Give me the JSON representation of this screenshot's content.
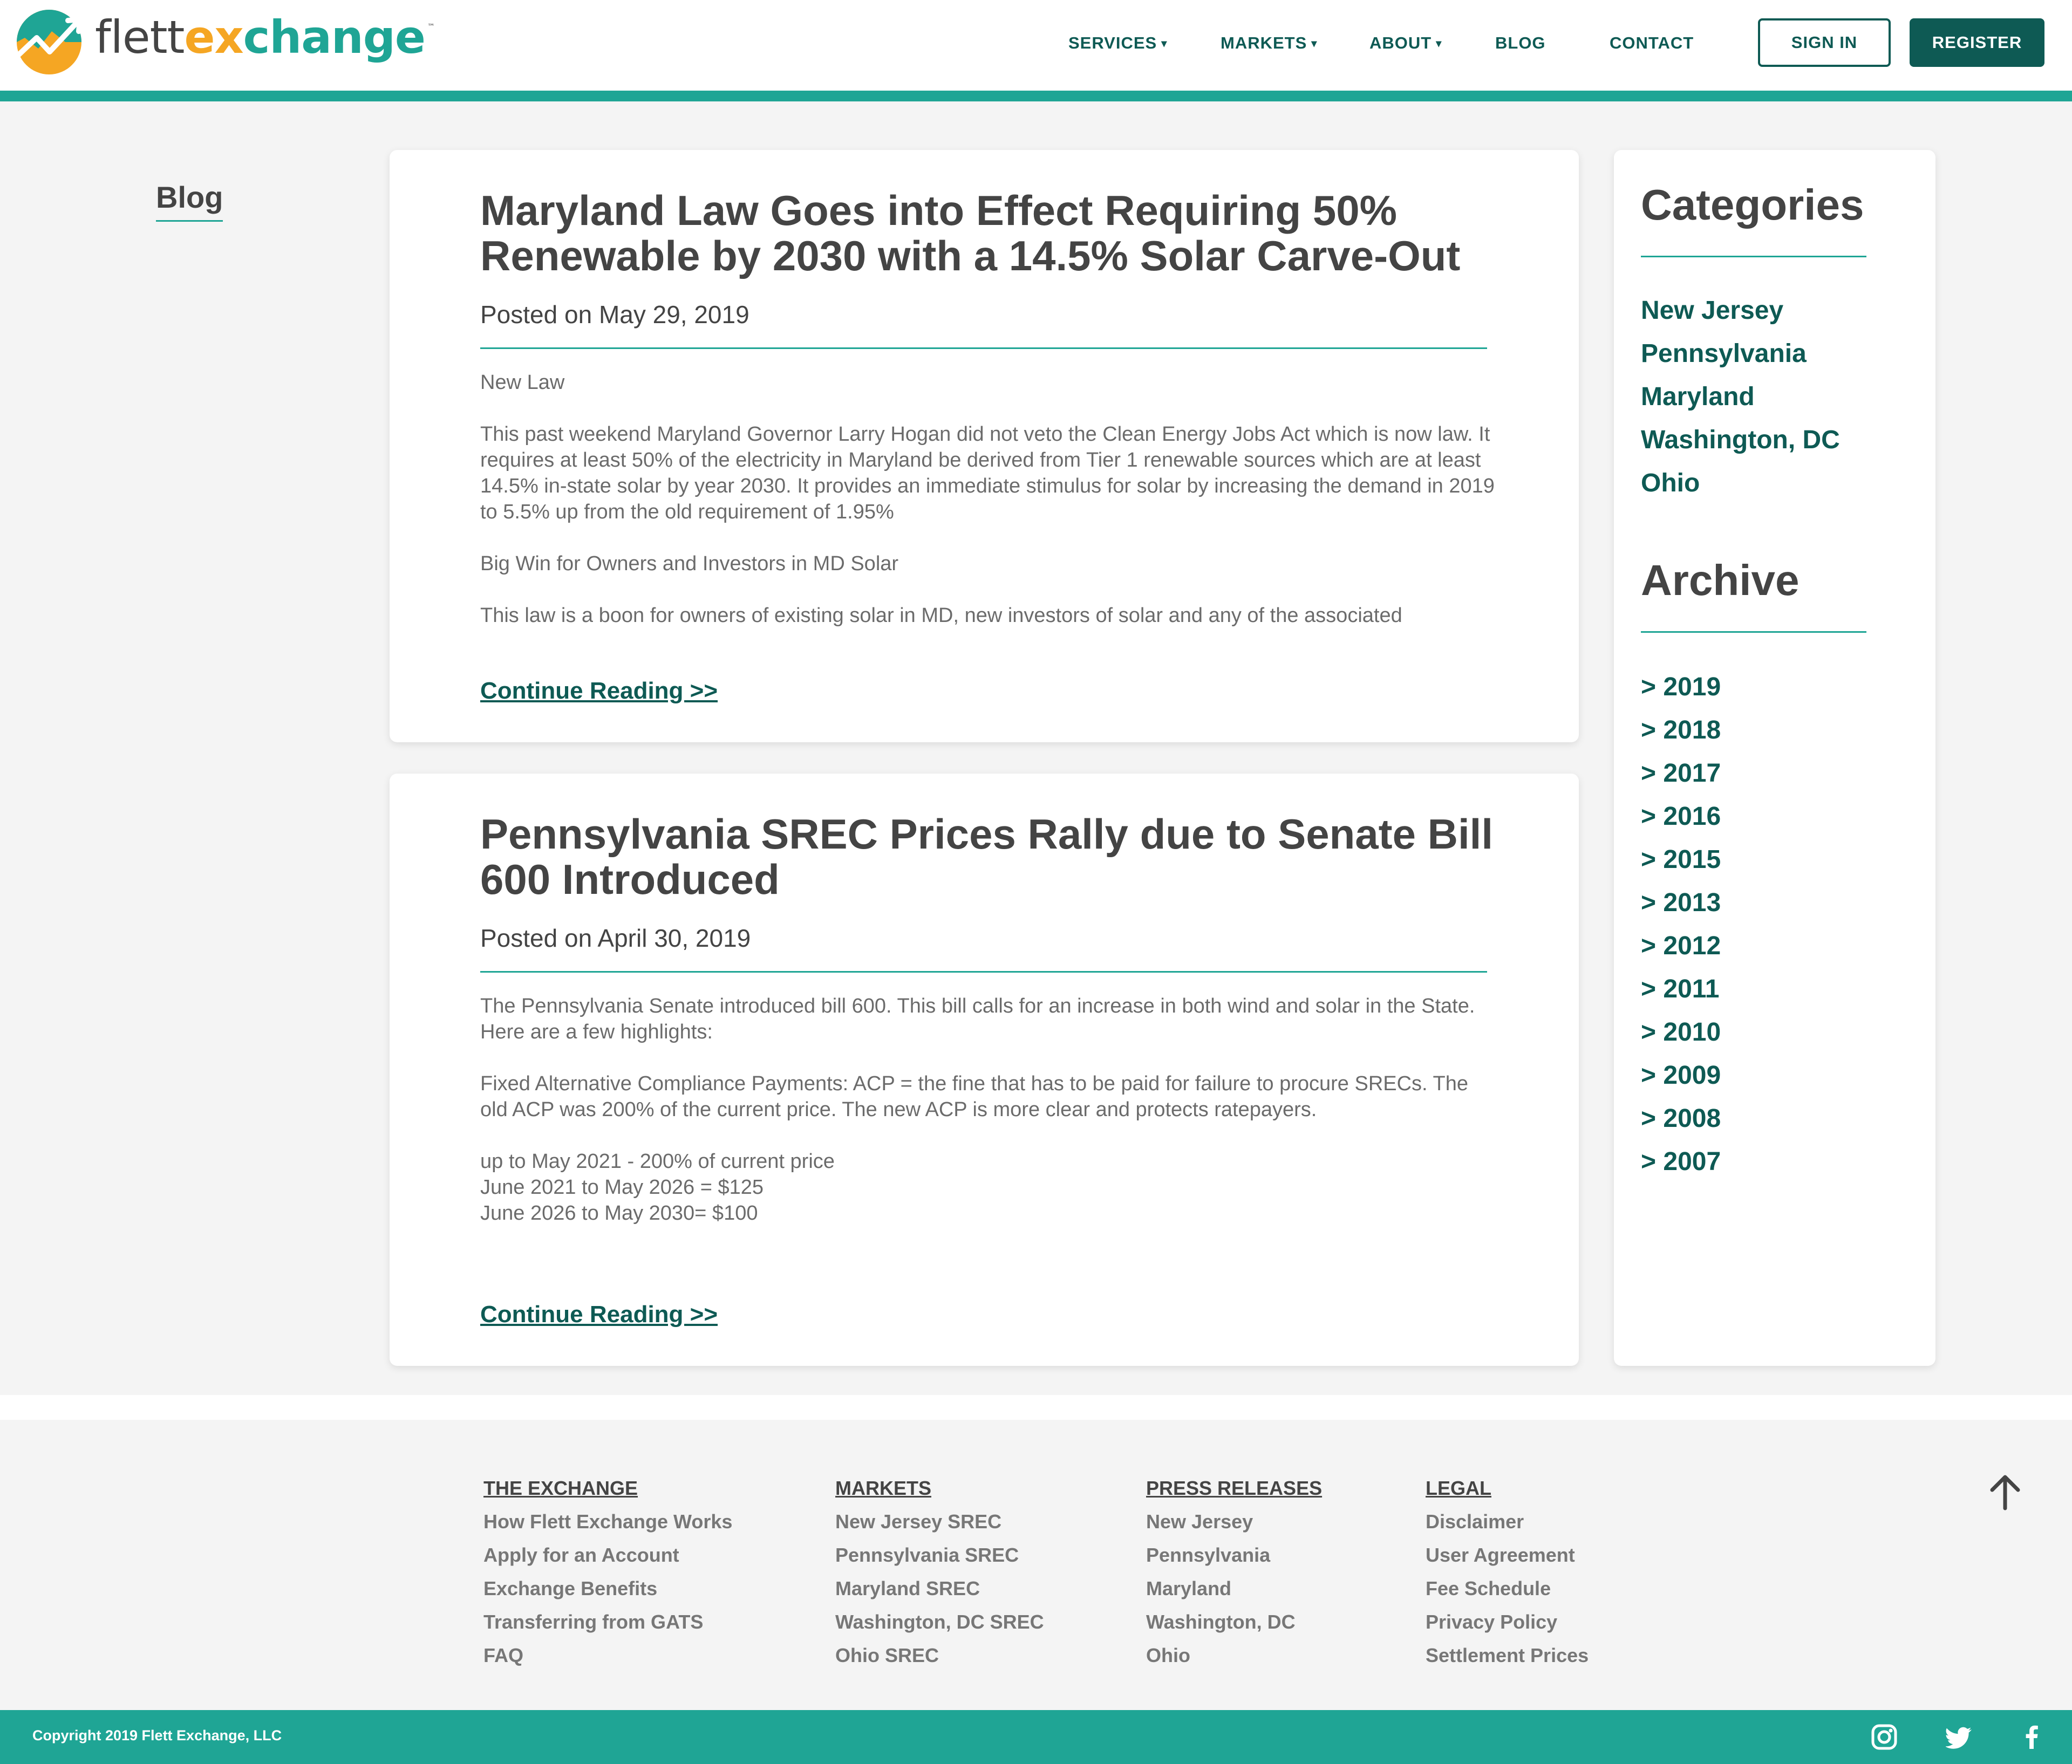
{
  "brand": {
    "name_part1": "flett",
    "name_part2": "ex",
    "name_part3": "change",
    "trademark": "™",
    "colors": {
      "teal": "#1fa595",
      "dark_teal": "#0e5a54",
      "orange": "#f5a623"
    }
  },
  "nav": {
    "items": [
      {
        "label": "SERVICES",
        "caret": "▾"
      },
      {
        "label": "MARKETS",
        "caret": "▾"
      },
      {
        "label": "ABOUT",
        "caret": "▾"
      },
      {
        "label": "BLOG",
        "caret": ""
      },
      {
        "label": "CONTACT",
        "caret": ""
      }
    ],
    "sign_in": "SIGN IN",
    "register": "REGISTER"
  },
  "page": {
    "section_label": "Blog"
  },
  "posts": [
    {
      "title": "Maryland Law Goes into Effect Requiring 50% Renewable by 2030 with a 14.5% Solar Carve-Out",
      "date": "Posted on May 29, 2019",
      "paragraphs": [
        "New Law",
        "This past weekend Maryland Governor Larry Hogan did not veto the Clean Energy Jobs Act which is now law. It requires at least 50% of the electricity in Maryland be derived from Tier 1 renewable sources which are at least 14.5% in-state solar by year 2030. It provides an immediate stimulus for solar by increasing the demand in 2019 to 5.5% up from the old requirement of 1.95%",
        "Big Win for Owners and Investors in MD Solar",
        "This law is a boon for owners of existing solar in MD, new investors of solar and any of the associated"
      ],
      "continue": "Continue Reading >>"
    },
    {
      "title": "Pennsylvania SREC Prices Rally due to Senate Bill 600 Introduced",
      "date": "Posted on April 30, 2019",
      "paragraphs": [
        "The Pennsylvania Senate introduced bill 600. This bill calls for an increase in both wind and solar in the State. Here are a few highlights:",
        "Fixed Alternative Compliance Payments: ACP = the fine that has to be paid for failure to procure SRECs. The old ACP was 200% of the current price. The new ACP is more clear and protects ratepayers.",
        "up to May 2021 - 200% of current price\nJune 2021 to May 2026 = $125\nJune 2026 to May 2030= $100"
      ],
      "continue": "Continue Reading >>"
    }
  ],
  "sidebar": {
    "categories_title": "Categories",
    "categories": [
      "New Jersey",
      "Pennsylvania",
      "Maryland",
      "Washington, DC",
      "Ohio"
    ],
    "archive_title": "Archive",
    "archive": [
      "> 2019",
      "> 2018",
      "> 2017",
      "> 2016",
      "> 2015",
      "> 2013",
      "> 2012",
      "> 2011",
      "> 2010",
      "> 2009",
      "> 2008",
      "> 2007"
    ]
  },
  "footer": {
    "columns": [
      {
        "heading": "THE EXCHANGE",
        "links": [
          "How Flett Exchange Works",
          "Apply for an Account",
          "Exchange Benefits",
          "Transferring from GATS",
          "FAQ"
        ]
      },
      {
        "heading": "MARKETS",
        "links": [
          "New Jersey SREC",
          "Pennsylvania SREC",
          "Maryland SREC",
          "Washington, DC SREC",
          "Ohio SREC"
        ]
      },
      {
        "heading": "PRESS RELEASES",
        "links": [
          "New Jersey",
          "Pennsylvania",
          "Maryland",
          "Washington, DC",
          "Ohio"
        ]
      },
      {
        "heading": "LEGAL",
        "links": [
          "Disclaimer",
          "User Agreement",
          "Fee Schedule",
          "Privacy Policy",
          "Settlement Prices"
        ]
      }
    ],
    "copyright": "Copyright 2019 Flett Exchange, LLC",
    "social_icons": [
      "instagram-icon",
      "twitter-icon",
      "facebook-icon"
    ],
    "back_to_top_icon": "arrow-up-icon"
  }
}
